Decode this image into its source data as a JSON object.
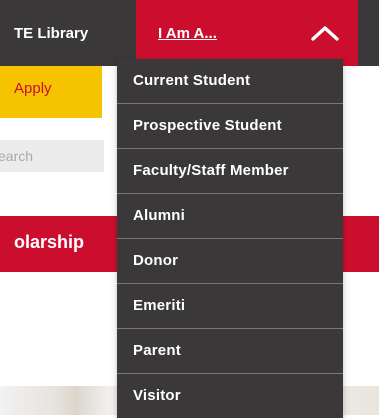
{
  "topbar": {
    "library_link": "TE Library",
    "i_am_toggle": "I Am A..."
  },
  "apply": {
    "label": "Apply"
  },
  "search": {
    "placeholder": "earch"
  },
  "banner": {
    "text": "olarship"
  },
  "dropdown": {
    "items": [
      {
        "label": "Current Student"
      },
      {
        "label": "Prospective Student"
      },
      {
        "label": "Faculty/Staff Member"
      },
      {
        "label": "Alumni"
      },
      {
        "label": "Donor"
      },
      {
        "label": "Emeriti"
      },
      {
        "label": "Parent"
      },
      {
        "label": "Visitor"
      }
    ]
  },
  "icons": {
    "toggle_chevron": "chevron-up-icon"
  },
  "colors": {
    "brand_red": "#cc0e2e",
    "dark_gray": "#3a3839",
    "gold": "#f6c300",
    "divider": "#77767a"
  }
}
